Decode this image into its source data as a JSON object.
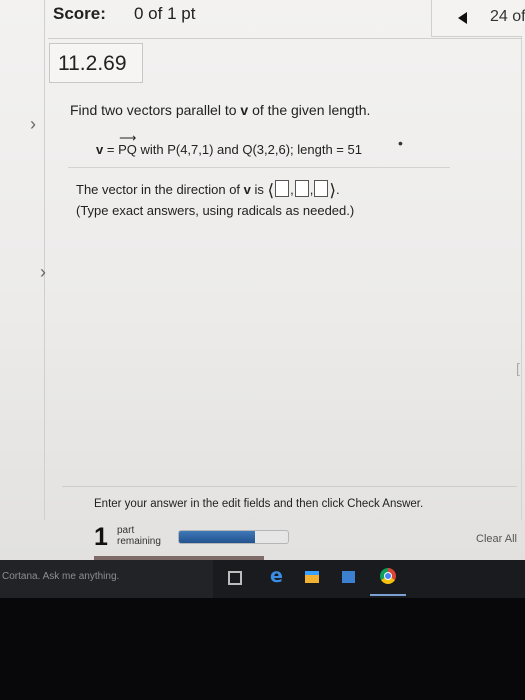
{
  "header": {
    "score_label": "Score:",
    "score_value": "0 of 1 pt",
    "counter": "24 of"
  },
  "question": {
    "id": "11.2.69",
    "prompt_parts": [
      "Find two vectors parallel to ",
      "v",
      " of the given length."
    ],
    "given": {
      "lhs": "v",
      "eq": " = ",
      "vector": "PQ",
      "arrow": "⟶",
      "rest": " with P(4,7,1) and Q(3,2,6); length = 51"
    },
    "answer_parts": [
      "The vector in the direction of ",
      "v",
      " is "
    ],
    "answer_brackets": [
      "⟨",
      "⟩",
      "."
    ],
    "answer_sep": ",",
    "hint": "(Type exact answers, using radicals as needed.)"
  },
  "footer": {
    "instructions": "Enter your answer in the edit fields and then click Check Answer.",
    "parts_count": "1",
    "parts_word1": "part",
    "parts_word2": "remaining",
    "progress": 0.7,
    "clear_all": "Clear All"
  },
  "taskbar": {
    "search_text": "Cortana. Ask me anything."
  },
  "colors": {
    "progress": "#2b5fa0",
    "taskbar": "#1a1b1f"
  },
  "icons": {
    "nav_prev": "left-triangle",
    "expand": "chevron-right",
    "edge": "edge-e",
    "chrome": "chrome-circle"
  }
}
